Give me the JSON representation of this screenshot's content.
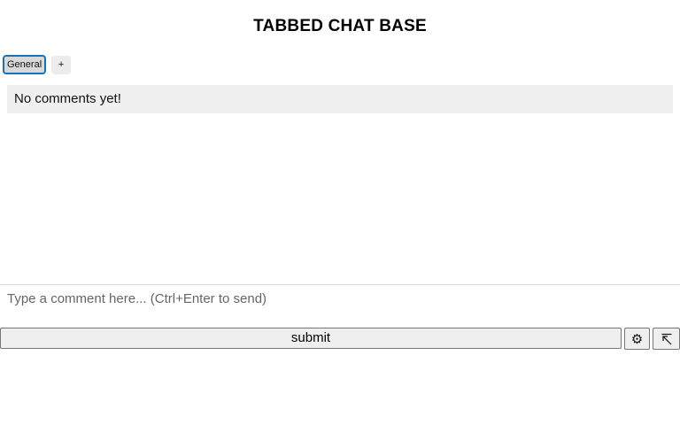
{
  "header": {
    "title": "TABBED CHAT BASE"
  },
  "tabs": [
    {
      "label": "General",
      "active": true
    }
  ],
  "add_tab_label": "+",
  "comments": {
    "empty_message": "No comments yet!"
  },
  "composer": {
    "placeholder": "Type a comment here... (Ctrl+Enter to send)",
    "value": "",
    "submit_label": "submit",
    "settings_icon": "gear-icon",
    "settings_glyph": "⚙",
    "popout_icon": "popout-arrow-icon"
  },
  "colors": {
    "active_tab_border": "#1a73b8",
    "comments_background": "#f0f0f0"
  }
}
